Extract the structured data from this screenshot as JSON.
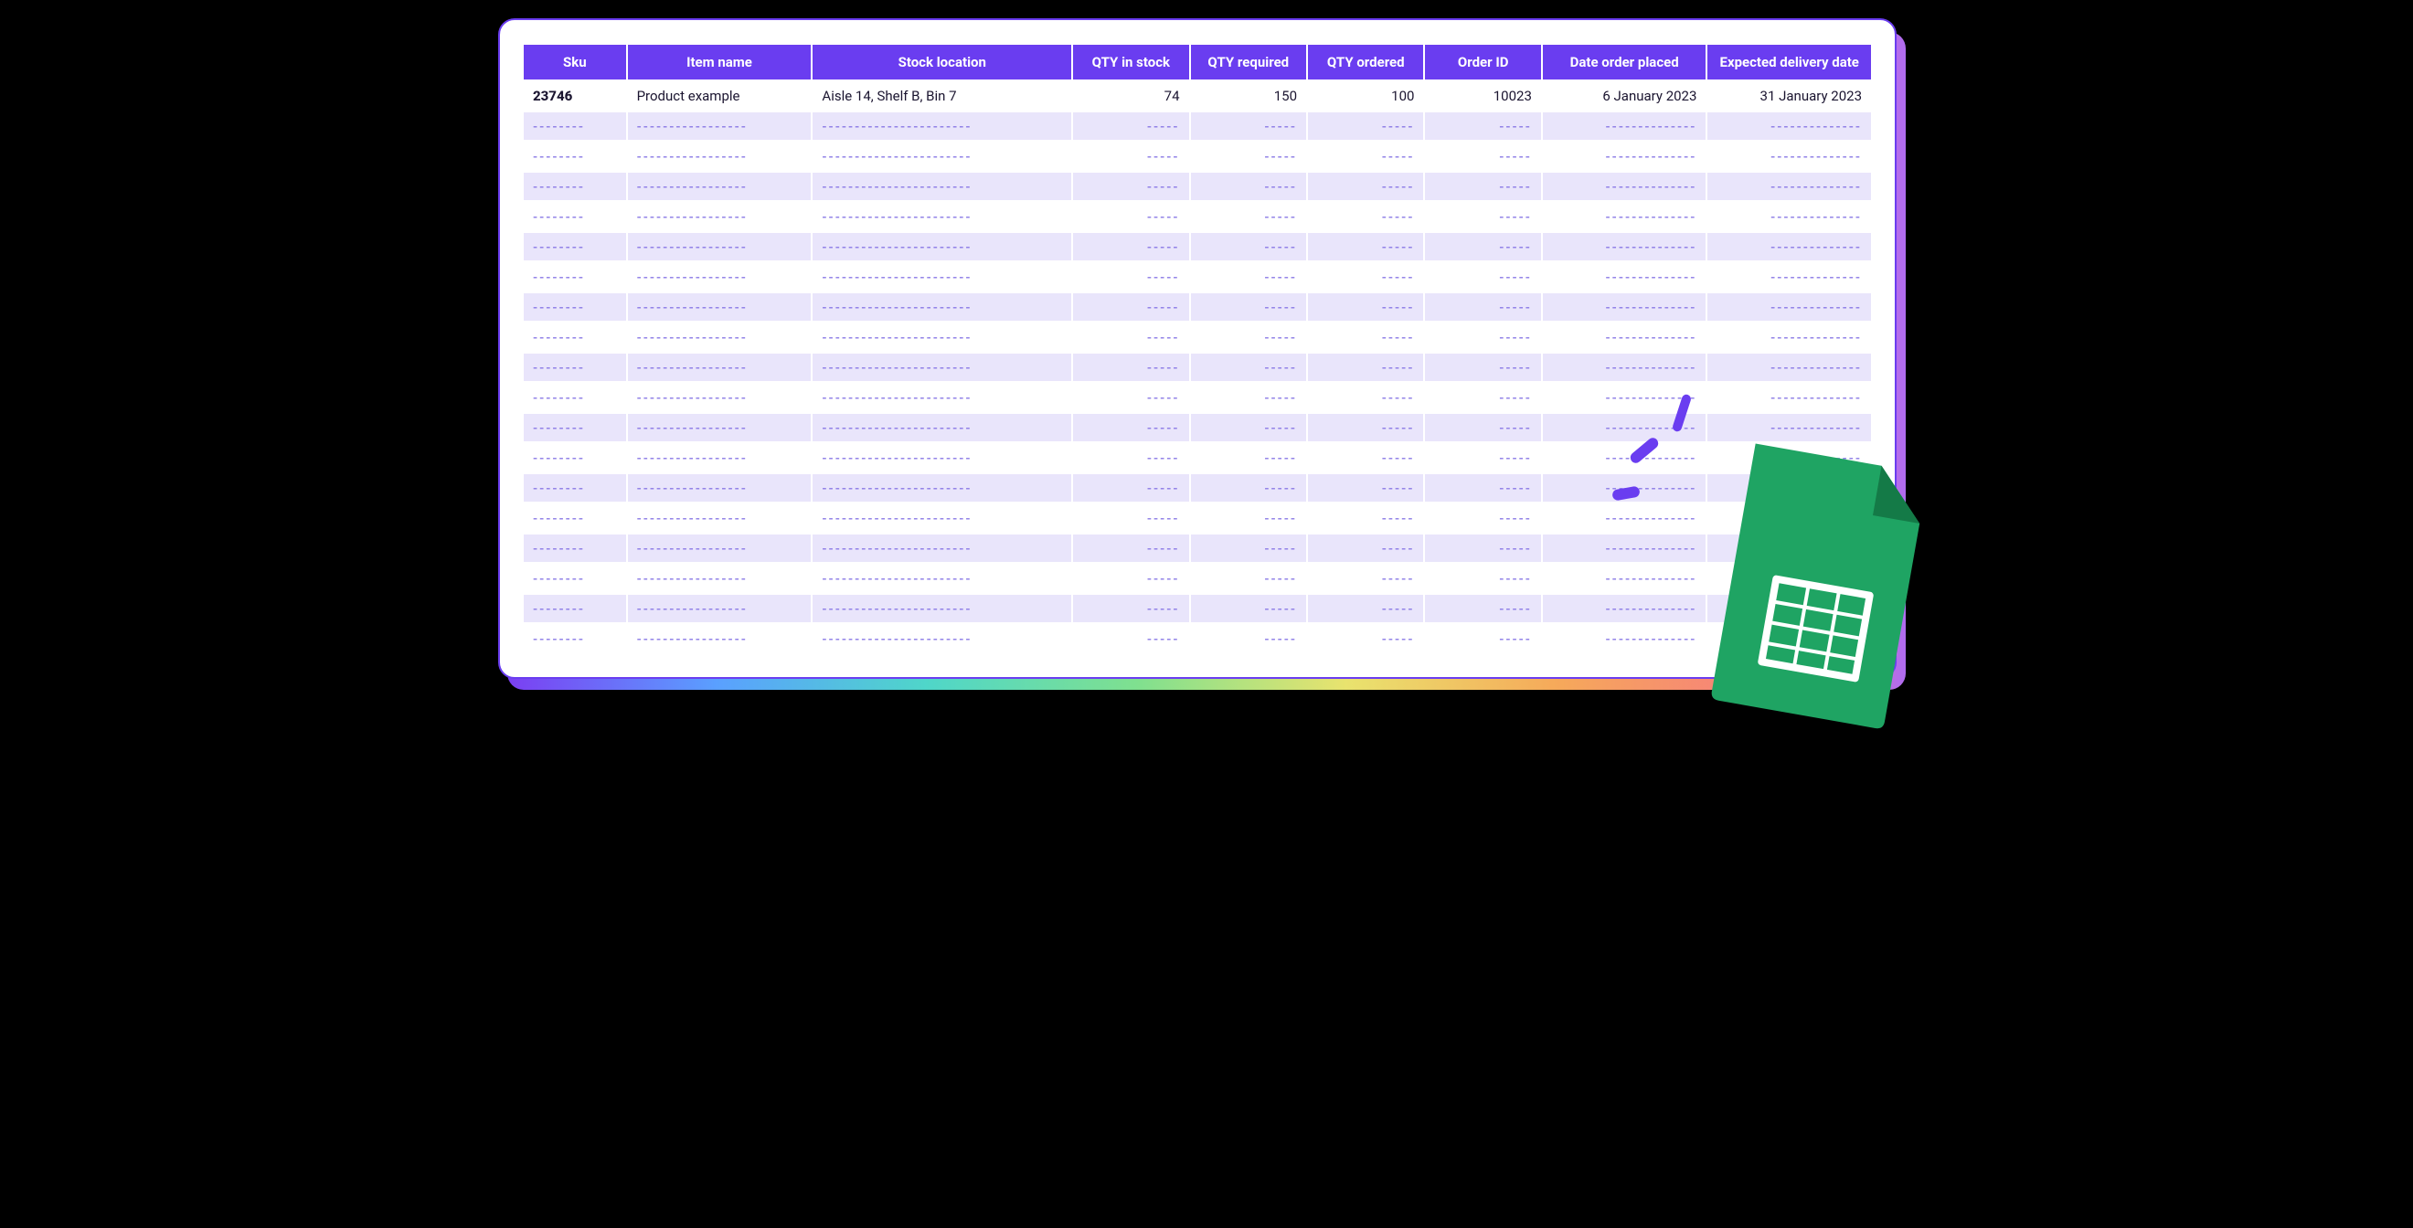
{
  "colors": {
    "accent": "#6a3df0",
    "sheet_green": "#1fa463"
  },
  "table": {
    "headers": {
      "sku": "Sku",
      "item_name": "Item name",
      "stock_location": "Stock location",
      "qty_in_stock": "QTY in stock",
      "qty_required": "QTY required",
      "qty_ordered": "QTY ordered",
      "order_id": "Order ID",
      "date_order_placed": "Date order placed",
      "expected_delivery_date": "Expected delivery date"
    },
    "rows": [
      {
        "sku": "23746",
        "item_name": "Product example",
        "stock_location": "Aisle 14, Shelf B, Bin 7",
        "qty_in_stock": "74",
        "qty_required": "150",
        "qty_ordered": "100",
        "order_id": "10023",
        "date_order_placed": "6 January 2023",
        "expected_delivery_date": "31 January 2023"
      }
    ],
    "placeholder_row_count": 18,
    "placeholder_patterns": {
      "sku": "--------",
      "item_name": "-----------------",
      "stock_location": "-----------------------",
      "qty_in_stock": "-----",
      "qty_required": "-----",
      "qty_ordered": "-----",
      "order_id": "-----",
      "date_order_placed": "--------------",
      "expected_delivery_date": "--------------"
    }
  },
  "icon": {
    "name": "google-sheets-icon"
  }
}
